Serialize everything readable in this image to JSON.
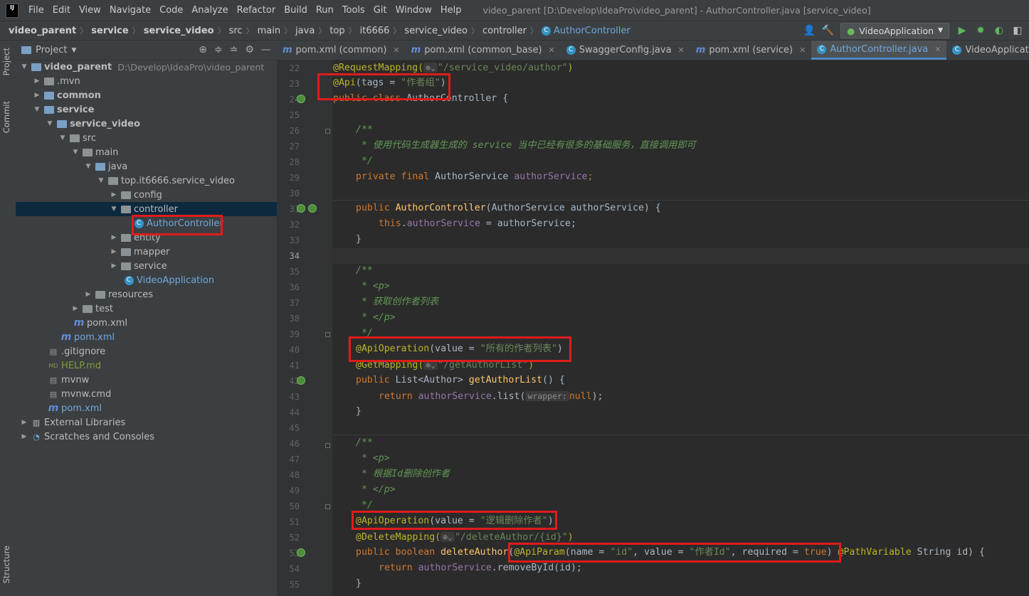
{
  "menubar": {
    "logo": "IJ",
    "items": [
      "File",
      "Edit",
      "View",
      "Navigate",
      "Code",
      "Analyze",
      "Refactor",
      "Build",
      "Run",
      "Tools",
      "Git",
      "Window",
      "Help"
    ],
    "window_title": "video_parent [D:\\Develop\\IdeaPro\\video_parent] - AuthorController.java [service_video]"
  },
  "breadcrumbs": [
    "video_parent",
    "service",
    "service_video",
    "src",
    "main",
    "java",
    "top",
    "it6666",
    "service_video",
    "controller",
    "AuthorController"
  ],
  "run_config": "VideoApplication",
  "left_strip": {
    "project": "Project",
    "commit": "Commit",
    "structure": "Structure"
  },
  "project_panel": {
    "title": "Project",
    "tree": [
      {
        "label": "video_parent",
        "path": "D:\\Develop\\IdeaPro\\video_parent"
      },
      {
        "label": ".mvn"
      },
      {
        "label": "common"
      },
      {
        "label": "service"
      },
      {
        "label": "service_video"
      },
      {
        "label": "src"
      },
      {
        "label": "main"
      },
      {
        "label": "java"
      },
      {
        "label": "top.it6666.service_video"
      },
      {
        "label": "config"
      },
      {
        "label": "controller"
      },
      {
        "label": "AuthorController"
      },
      {
        "label": "entity"
      },
      {
        "label": "mapper"
      },
      {
        "label": "service"
      },
      {
        "label": "VideoApplication"
      },
      {
        "label": "resources"
      },
      {
        "label": "test"
      },
      {
        "label": "pom.xml"
      },
      {
        "label": "pom.xml"
      },
      {
        "label": ".gitignore"
      },
      {
        "label": "HELP.md"
      },
      {
        "label": "mvnw"
      },
      {
        "label": "mvnw.cmd"
      },
      {
        "label": "pom.xml"
      },
      {
        "label": "External Libraries"
      },
      {
        "label": "Scratches and Consoles"
      }
    ]
  },
  "tabs": [
    {
      "label": "pom.xml (common)"
    },
    {
      "label": "pom.xml (common_base)"
    },
    {
      "label": "SwaggerConfig.java"
    },
    {
      "label": "pom.xml (service)"
    },
    {
      "label": "AuthorController.java"
    },
    {
      "label": "VideoApplication.java"
    }
  ],
  "editor": {
    "line_numbers": [
      "22",
      "23",
      "24",
      "25",
      "26",
      "27",
      "28",
      "29",
      "30",
      "31",
      "32",
      "33",
      "34",
      "35",
      "36",
      "37",
      "38",
      "39",
      "40",
      "41",
      "42",
      "43",
      "44",
      "45",
      "46",
      "47",
      "48",
      "49",
      "50",
      "51",
      "52",
      "53",
      "54",
      "55"
    ],
    "code": {
      "l22a": "@RequestMapping(",
      "l22b": "\"/service_video/author\"",
      "l22c": ")",
      "l23a": "@Api",
      "l23b": "(tags = ",
      "l23c": "\"作者组\"",
      "l23d": ")",
      "l24a": "public class ",
      "l24b": "AuthorController {",
      "l26": "/**",
      "l27": " * 使用代码生成器生成的 service 当中已经有很多的基础服务，直接调用即可",
      "l28": " */",
      "l29a": "private final ",
      "l29b": "AuthorService ",
      "l29c": "authorService",
      "l29d": ";",
      "l31a": "public ",
      "l31b": "AuthorController",
      "l31c": "(AuthorService authorService) {",
      "l32a": "this",
      "l32b": ".",
      "l32c": "authorService",
      "l32d": " = authorService;",
      "l33": "}",
      "l35": "/**",
      "l36": " * <p>",
      "l37": " * 获取创作者列表",
      "l38": " * </p>",
      "l39": " */",
      "l40a": "@ApiOperation",
      "l40b": "(value = ",
      "l40c": "\"所有的作者列表\"",
      "l40d": ")",
      "l41a": "@GetMapping(",
      "l41b": "\"/getAuthorList\"",
      "l41c": ")",
      "l42a": "public ",
      "l42b": "List<Author> ",
      "l42c": "getAuthorList",
      "l42d": "() {",
      "l43a": "return ",
      "l43b": "authorService",
      "l43c": ".list(",
      "l43h": "wrapper:",
      "l43d": "null",
      "l43e": ");",
      "l44": "}",
      "l46": "/**",
      "l47": " * <p>",
      "l48": " * 根据Id删除创作者",
      "l49": " * </p>",
      "l50": " */",
      "l51a": "@ApiOperation",
      "l51b": "(value = ",
      "l51c": "\"逻辑删除作者\"",
      "l51d": ")",
      "l52a": "@DeleteMapping(",
      "l52b": "\"/deleteAuthor/{id}\"",
      "l52c": ")",
      "l53a": "public boolean ",
      "l53b": "deleteAuthor",
      "l53c": "(",
      "l53d": "@ApiParam",
      "l53e": "(name = ",
      "l53f": "\"id\"",
      "l53g": ", value = ",
      "l53h": "\"作者Id\"",
      "l53i": ", required = ",
      "l53j": "true",
      "l53k": ") ",
      "l53l": "@PathVariable ",
      "l53m": "String id) {",
      "l54a": "return ",
      "l54b": "authorService",
      "l54c": ".removeById(id);",
      "l55": "}"
    }
  },
  "colors": {
    "highlight_box": "#e01b1b",
    "selected_row": "#0d293e",
    "keyword": "#cc7832",
    "string": "#6a8759",
    "annotation": "#bbb529"
  }
}
